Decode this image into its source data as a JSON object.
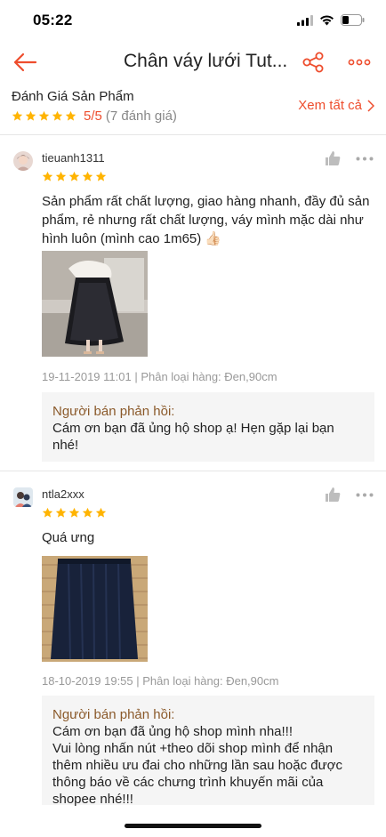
{
  "status_bar": {
    "time": "05:22"
  },
  "nav": {
    "title": "Chân váy lưới Tut..."
  },
  "summary": {
    "title": "Đánh Giá Sản Phẩm",
    "score": "5/5",
    "count": "(7 đánh giá)",
    "see_all": "Xem tất cả"
  },
  "colors": {
    "accent": "#ee4d2d",
    "star": "#ffb400",
    "reply_label": "#8b5a2b",
    "reply_bg": "#f5f5f5"
  },
  "reviews": [
    {
      "username": "tieuanh1311",
      "rating": 5,
      "text": "Sản phẩm rất chất lượng, giao hàng nhanh, đầy đủ sản phẩm, rẻ nhưng rất chất lượng, váy mình mặc dài như hình luôn (mình cao 1m65) 👍🏻",
      "meta": "19-11-2019 11:01 | Phân loại hàng: Đen,90cm",
      "reply_label": "Người bán phản hồi:",
      "reply_text": "Cám ơn bạn đã ủng hộ shop ạ! Hẹn gặp lại bạn nhé!"
    },
    {
      "username": "ntla2xxx",
      "rating": 5,
      "text": "Quá ưng",
      "meta": "18-10-2019 19:55 | Phân loại hàng: Đen,90cm",
      "reply_label": "Người bán phản hồi:",
      "reply_text": "Cám ơn bạn đã ủng hộ shop mình nha!!!\nVui lòng nhấn nút +theo dõi shop mình để nhận thêm nhiều ưu đai cho những lần sau hoặc được thông báo về các chưng trình khuyến mãi của shopee nhé!!!"
    }
  ]
}
